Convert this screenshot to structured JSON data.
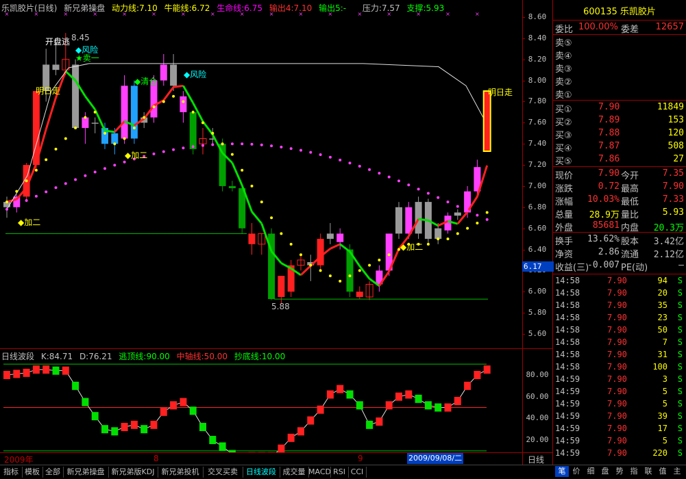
{
  "header": {
    "title": "乐凯胶片(日线)",
    "indicator": "新兄弟操盘",
    "dongli": "动力线:7.10",
    "niuneng": "牛能线:6.72",
    "shengming": "生命线:6.75",
    "shuchu4": "输出4:7.10",
    "shuchu5": "输出5:-",
    "yali": "压力:7.57",
    "zhicheng": "支撑:5.93"
  },
  "price_axis": {
    "ticks": [
      "8.60",
      "8.40",
      "8.20",
      "8.00",
      "7.80",
      "7.60",
      "7.40",
      "7.20",
      "7.00",
      "6.80",
      "6.60",
      "6.40",
      "6.20",
      "6.00",
      "5.80",
      "5.60"
    ],
    "current_label": "6.17"
  },
  "annotations": {
    "kaipan": "开盘逃",
    "high_label": "8.45",
    "fengxian1": "◆风险",
    "mai1": "★卖一",
    "mingrizou1": "明日走",
    "qingcang": "◆清仓",
    "fengxian2": "◆风险",
    "mai_small": "卖一",
    "jia2_a": "◆加二",
    "jia2_b": "◆加二",
    "jia2_c": "◆加二",
    "low_label": "5.88",
    "mingrizou2": "明日走"
  },
  "sub": {
    "title": "日线波段",
    "k": "K:84.71",
    "d": "D:76.21",
    "taoding": "逃顶线:90.00",
    "zhongzhou": "中轴线:50.00",
    "chaodi": "抄底线:10.00",
    "ticks": [
      "80.00",
      "60.00",
      "40.00",
      "20.00"
    ]
  },
  "date_axis": {
    "start": "2009年",
    "m8": "8",
    "m9": "9",
    "cursor_date": "2009/09/08/二",
    "period": "日线"
  },
  "quote": {
    "code_name": "600135 乐凯胶片",
    "weibi_label": "委比",
    "weibi_value": "100.00%",
    "weicha_label": "委差",
    "weicha_value": "12657",
    "sells": [
      {
        "label": "卖⑤",
        "price": "",
        "vol": ""
      },
      {
        "label": "卖④",
        "price": "",
        "vol": ""
      },
      {
        "label": "卖③",
        "price": "",
        "vol": ""
      },
      {
        "label": "卖②",
        "price": "",
        "vol": ""
      },
      {
        "label": "卖①",
        "price": "",
        "vol": ""
      }
    ],
    "buys": [
      {
        "label": "买①",
        "price": "7.90",
        "vol": "11849"
      },
      {
        "label": "买②",
        "price": "7.89",
        "vol": "153"
      },
      {
        "label": "买③",
        "price": "7.88",
        "vol": "120"
      },
      {
        "label": "买④",
        "price": "7.87",
        "vol": "508"
      },
      {
        "label": "买⑤",
        "price": "7.86",
        "vol": "27"
      }
    ],
    "stats": [
      {
        "l1": "现价",
        "v1": "7.90",
        "l2": "今开",
        "v2": "7.35"
      },
      {
        "l1": "涨跌",
        "v1": "0.72",
        "l2": "最高",
        "v2": "7.90"
      },
      {
        "l1": "涨幅",
        "v1": "10.03%",
        "l2": "最低",
        "v2": "7.33"
      },
      {
        "l1": "总量",
        "v1": "28.9万",
        "l2": "量比",
        "v2": "5.93"
      },
      {
        "l1": "外盘",
        "v1": "85681",
        "l2": "内盘",
        "v2": "20.3万"
      }
    ],
    "stats2": [
      {
        "l1": "换手",
        "v1": "13.62%",
        "l2": "股本",
        "v2": "3.42亿"
      },
      {
        "l1": "净资",
        "v1": "2.86",
        "l2": "流通",
        "v2": "2.12亿"
      },
      {
        "l1": "收益(三)",
        "v1": "-0.007",
        "l2": "PE(动)",
        "v2": "—"
      }
    ]
  },
  "trades": [
    {
      "time": "14:58",
      "price": "7.90",
      "vol": "94",
      "side": "S"
    },
    {
      "time": "14:58",
      "price": "7.90",
      "vol": "20",
      "side": "S"
    },
    {
      "time": "14:58",
      "price": "7.90",
      "vol": "35",
      "side": "S"
    },
    {
      "time": "14:58",
      "price": "7.90",
      "vol": "23",
      "side": "S"
    },
    {
      "time": "14:58",
      "price": "7.90",
      "vol": "50",
      "side": "S"
    },
    {
      "time": "14:58",
      "price": "7.90",
      "vol": "7",
      "side": "S"
    },
    {
      "time": "14:58",
      "price": "7.90",
      "vol": "31",
      "side": "S"
    },
    {
      "time": "14:58",
      "price": "7.90",
      "vol": "100",
      "side": "S"
    },
    {
      "time": "14:59",
      "price": "7.90",
      "vol": "3",
      "side": "S"
    },
    {
      "time": "14:59",
      "price": "7.90",
      "vol": "5",
      "side": "S"
    },
    {
      "time": "14:59",
      "price": "7.90",
      "vol": "5",
      "side": "S"
    },
    {
      "time": "14:59",
      "price": "7.90",
      "vol": "39",
      "side": "S"
    },
    {
      "time": "14:59",
      "price": "7.90",
      "vol": "17",
      "side": "S"
    },
    {
      "time": "14:59",
      "price": "7.90",
      "vol": "5",
      "side": "S"
    },
    {
      "time": "14:59",
      "price": "7.90",
      "vol": "220",
      "side": "S"
    }
  ],
  "tabs": [
    "指标",
    "模板",
    "全部",
    "新兄弟操盘",
    "新兄弟版KDJ",
    "新兄弟投机",
    "交叉买卖",
    "日线波段",
    "成交量",
    "MACD",
    "RSI",
    "CCI"
  ],
  "right_tabs": [
    "笔",
    "价",
    "细",
    "盘",
    "势",
    "指",
    "联",
    "值",
    "主"
  ],
  "chart_data": {
    "type": "candlestick",
    "y_range": [
      5.5,
      8.65
    ],
    "candles": [
      {
        "o": 6.8,
        "h": 6.9,
        "l": 6.7,
        "c": 6.85,
        "color": "gray"
      },
      {
        "o": 6.8,
        "h": 6.92,
        "l": 6.75,
        "c": 6.9,
        "color": "magenta"
      },
      {
        "o": 6.9,
        "h": 7.22,
        "l": 6.85,
        "c": 7.2,
        "color": "red"
      },
      {
        "o": 7.2,
        "h": 7.9,
        "l": 7.15,
        "c": 7.9,
        "color": "red"
      },
      {
        "o": 7.9,
        "h": 8.3,
        "l": 7.8,
        "c": 8.15,
        "color": "gray"
      },
      {
        "o": 8.15,
        "h": 8.4,
        "l": 8.05,
        "c": 8.1,
        "color": "gray"
      },
      {
        "o": 8.1,
        "h": 8.45,
        "l": 8.05,
        "c": 8.2,
        "color": "red"
      },
      {
        "o": 8.15,
        "h": 8.2,
        "l": 7.55,
        "c": 7.55,
        "color": "gray"
      },
      {
        "o": 7.65,
        "h": 7.7,
        "l": 7.4,
        "c": 7.55,
        "color": "magenta"
      },
      {
        "o": 7.6,
        "h": 7.65,
        "l": 7.5,
        "c": 7.6,
        "color": "gray"
      },
      {
        "o": 7.55,
        "h": 7.6,
        "l": 7.35,
        "c": 7.4,
        "color": "cyan"
      },
      {
        "o": 7.4,
        "h": 7.55,
        "l": 7.3,
        "c": 7.5,
        "color": "cyan"
      },
      {
        "o": 7.45,
        "h": 8.05,
        "l": 7.4,
        "c": 7.95,
        "color": "magenta"
      },
      {
        "o": 7.95,
        "h": 8.0,
        "l": 7.4,
        "c": 7.45,
        "color": "cyan"
      },
      {
        "o": 7.6,
        "h": 7.7,
        "l": 7.55,
        "c": 7.65,
        "color": "gray"
      },
      {
        "o": 7.65,
        "h": 8.05,
        "l": 7.6,
        "c": 8.0,
        "color": "magenta"
      },
      {
        "o": 8.0,
        "h": 8.25,
        "l": 7.95,
        "c": 8.15,
        "color": "magenta"
      },
      {
        "o": 8.15,
        "h": 8.25,
        "l": 7.9,
        "c": 7.95,
        "color": "gray"
      },
      {
        "o": 7.85,
        "h": 7.9,
        "l": 7.6,
        "c": 7.7,
        "color": "magenta"
      },
      {
        "o": 7.7,
        "h": 7.72,
        "l": 7.3,
        "c": 7.35,
        "color": "green"
      },
      {
        "o": 7.4,
        "h": 7.55,
        "l": 7.3,
        "c": 7.45,
        "color": "red"
      },
      {
        "o": 7.45,
        "h": 7.55,
        "l": 7.4,
        "c": 7.45,
        "color": "gray"
      },
      {
        "o": 7.4,
        "h": 7.45,
        "l": 6.95,
        "c": 7.0,
        "color": "green"
      },
      {
        "o": 7.0,
        "h": 7.05,
        "l": 6.95,
        "c": 6.98,
        "color": "green"
      },
      {
        "o": 6.98,
        "h": 7.0,
        "l": 6.55,
        "c": 6.6,
        "color": "green"
      },
      {
        "o": 6.55,
        "h": 6.65,
        "l": 6.35,
        "c": 6.45,
        "color": "red"
      },
      {
        "o": 6.45,
        "h": 6.55,
        "l": 6.35,
        "c": 6.55,
        "color": "red"
      },
      {
        "o": 6.55,
        "h": 6.6,
        "l": 5.92,
        "c": 5.93,
        "color": "green"
      },
      {
        "o": 5.95,
        "h": 6.15,
        "l": 5.88,
        "c": 6.15,
        "color": "red"
      },
      {
        "o": 6.0,
        "h": 6.3,
        "l": 5.95,
        "c": 6.25,
        "color": "red"
      },
      {
        "o": 6.25,
        "h": 6.35,
        "l": 6.2,
        "c": 6.3,
        "color": "red"
      },
      {
        "o": 6.25,
        "h": 6.35,
        "l": 6.1,
        "c": 6.28,
        "color": "gray"
      },
      {
        "o": 6.25,
        "h": 6.55,
        "l": 6.2,
        "c": 6.5,
        "color": "red"
      },
      {
        "o": 6.5,
        "h": 6.65,
        "l": 6.45,
        "c": 6.55,
        "color": "gray"
      },
      {
        "o": 6.55,
        "h": 6.6,
        "l": 6.4,
        "c": 6.47,
        "color": "magenta"
      },
      {
        "o": 6.4,
        "h": 6.45,
        "l": 5.95,
        "c": 6.0,
        "color": "green"
      },
      {
        "o": 6.0,
        "h": 6.05,
        "l": 5.93,
        "c": 5.95,
        "color": "red"
      },
      {
        "o": 5.95,
        "h": 6.1,
        "l": 5.92,
        "c": 6.07,
        "color": "red"
      },
      {
        "o": 6.07,
        "h": 6.25,
        "l": 6.0,
        "c": 6.2,
        "color": "magenta"
      },
      {
        "o": 6.2,
        "h": 6.55,
        "l": 6.15,
        "c": 6.55,
        "color": "magenta"
      },
      {
        "o": 6.55,
        "h": 6.85,
        "l": 6.5,
        "c": 6.8,
        "color": "gray"
      },
      {
        "o": 6.8,
        "h": 6.85,
        "l": 6.5,
        "c": 6.55,
        "color": "magenta"
      },
      {
        "o": 6.55,
        "h": 6.9,
        "l": 6.5,
        "c": 6.85,
        "color": "gray"
      },
      {
        "o": 6.85,
        "h": 6.88,
        "l": 6.45,
        "c": 6.5,
        "color": "gray"
      },
      {
        "o": 6.5,
        "h": 6.65,
        "l": 6.45,
        "c": 6.6,
        "color": "gray"
      },
      {
        "o": 6.58,
        "h": 6.75,
        "l": 6.55,
        "c": 6.72,
        "color": "magenta"
      },
      {
        "o": 6.72,
        "h": 6.78,
        "l": 6.68,
        "c": 6.75,
        "color": "gray"
      },
      {
        "o": 6.75,
        "h": 7.0,
        "l": 6.7,
        "c": 6.95,
        "color": "magenta"
      },
      {
        "o": 6.95,
        "h": 7.25,
        "l": 6.9,
        "c": 7.18,
        "color": "magenta"
      },
      {
        "o": 7.33,
        "h": 7.9,
        "l": 7.33,
        "c": 7.9,
        "color": "redyellow"
      }
    ],
    "sub_kd": {
      "k": [
        80,
        81,
        82,
        85,
        85,
        84,
        84,
        70,
        55,
        42,
        30,
        28,
        32,
        34,
        30,
        34,
        46,
        52,
        55,
        47,
        32,
        20,
        14,
        7,
        3,
        5,
        5,
        5,
        12,
        22,
        28,
        38,
        48,
        62,
        67,
        62,
        52,
        34,
        37,
        52,
        60,
        62,
        58,
        52,
        50,
        50,
        56,
        70,
        80,
        85
      ],
      "range": [
        0,
        100
      ],
      "lines": [
        90,
        50,
        10
      ]
    }
  }
}
